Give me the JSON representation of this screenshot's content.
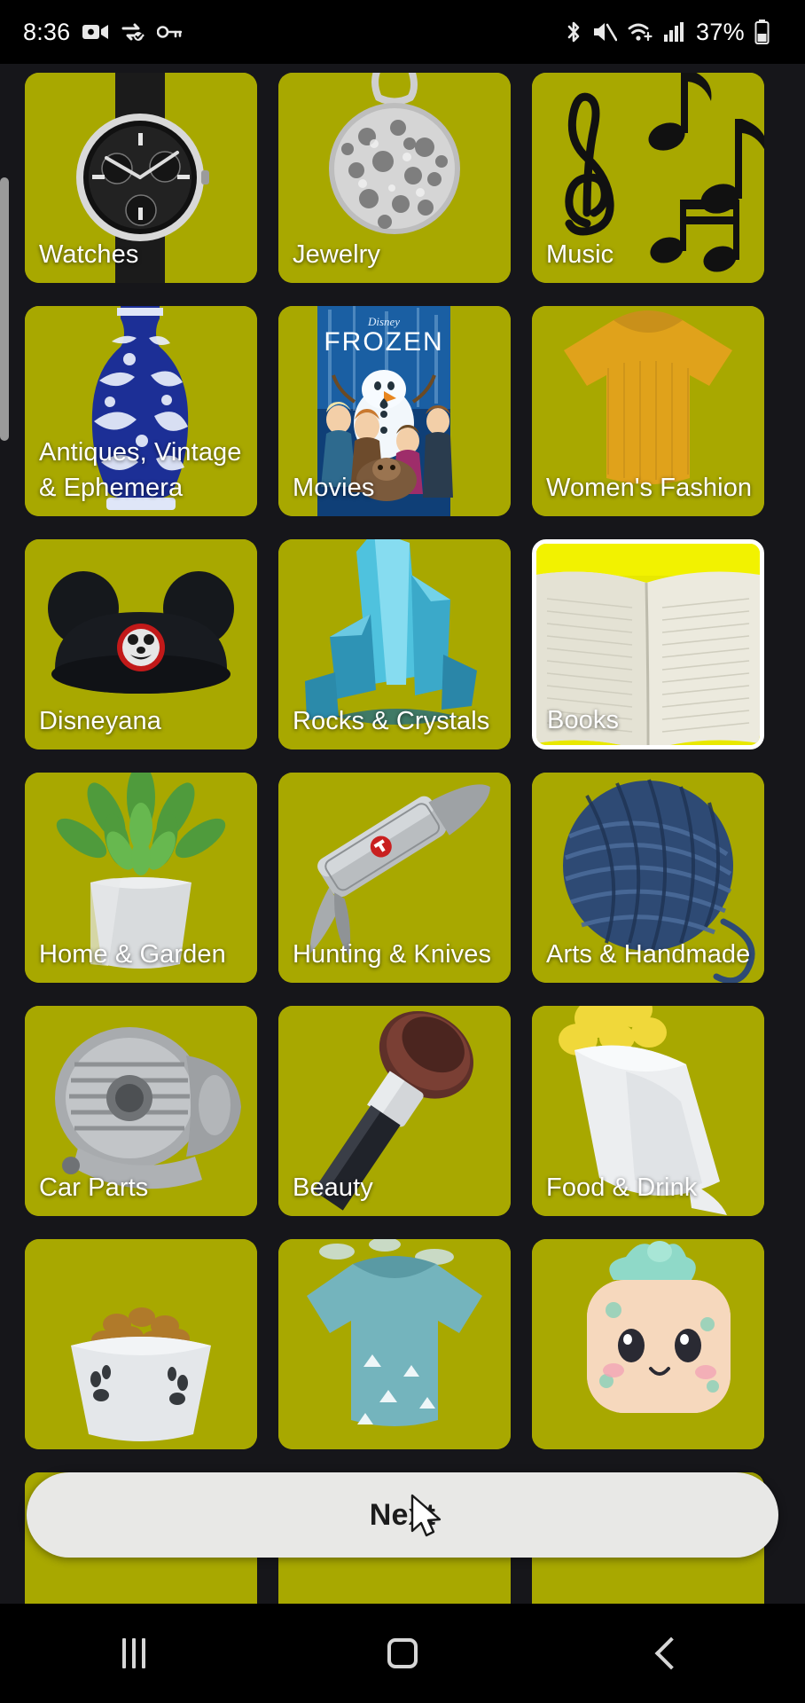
{
  "status_bar": {
    "clock": "8:36",
    "battery_percent": "37%",
    "left_icons": [
      "video-camera-icon",
      "data-saver-icon",
      "vpn-key-icon"
    ],
    "right_icons": [
      "bluetooth-icon",
      "mute-icon",
      "wifi-icon",
      "signal-icon",
      "battery-icon"
    ]
  },
  "colors": {
    "tile_background": "#a8a800",
    "tile_background_selected": "#e8e800",
    "selected_border": "#ffffff",
    "page_background": "#16161a",
    "label_text": "#ffffff",
    "next_button_background": "#e8e8e6",
    "next_button_text": "#1c1c1c",
    "scrollbar": "#9a9a9a"
  },
  "grid": {
    "columns": 3,
    "tiles": [
      {
        "label": "Watches",
        "art": "watch",
        "selected": false
      },
      {
        "label": "Jewelry",
        "art": "pendant",
        "selected": false
      },
      {
        "label": "Music",
        "art": "notes",
        "selected": false
      },
      {
        "label": "Antiques, Vintage & Ephemera",
        "art": "vase",
        "selected": false
      },
      {
        "label": "Movies",
        "art": "frozen",
        "selected": false
      },
      {
        "label": "Women's Fashion",
        "art": "sweater",
        "selected": false
      },
      {
        "label": "Disneyana",
        "art": "mouseears",
        "selected": false
      },
      {
        "label": "Rocks & Crystals",
        "art": "crystal",
        "selected": false
      },
      {
        "label": "Books",
        "art": "openbook",
        "selected": true
      },
      {
        "label": "Home & Garden",
        "art": "succulent",
        "selected": false
      },
      {
        "label": "Hunting & Knives",
        "art": "multitool",
        "selected": false
      },
      {
        "label": "Arts & Handmade",
        "art": "yarn",
        "selected": false
      },
      {
        "label": "Car Parts",
        "art": "waterpump",
        "selected": false
      },
      {
        "label": "Beauty",
        "art": "brush",
        "selected": false
      },
      {
        "label": "Food & Drink",
        "art": "fooddrink",
        "selected": false
      },
      {
        "label": "",
        "art": "petfood",
        "selected": false
      },
      {
        "label": "",
        "art": "onesie",
        "selected": false
      },
      {
        "label": "",
        "art": "plush",
        "selected": false
      },
      {
        "label": "",
        "art": "blank1",
        "selected": false
      },
      {
        "label": "",
        "art": "blank2",
        "selected": false
      },
      {
        "label": "",
        "art": "blank3",
        "selected": false
      }
    ]
  },
  "movies_art": {
    "title": "FROZEN",
    "studio": "Disney"
  },
  "next_button": {
    "label": "Next"
  },
  "nav_bar": {
    "recents": "recents-button",
    "home": "home-button",
    "back": "back-button"
  }
}
